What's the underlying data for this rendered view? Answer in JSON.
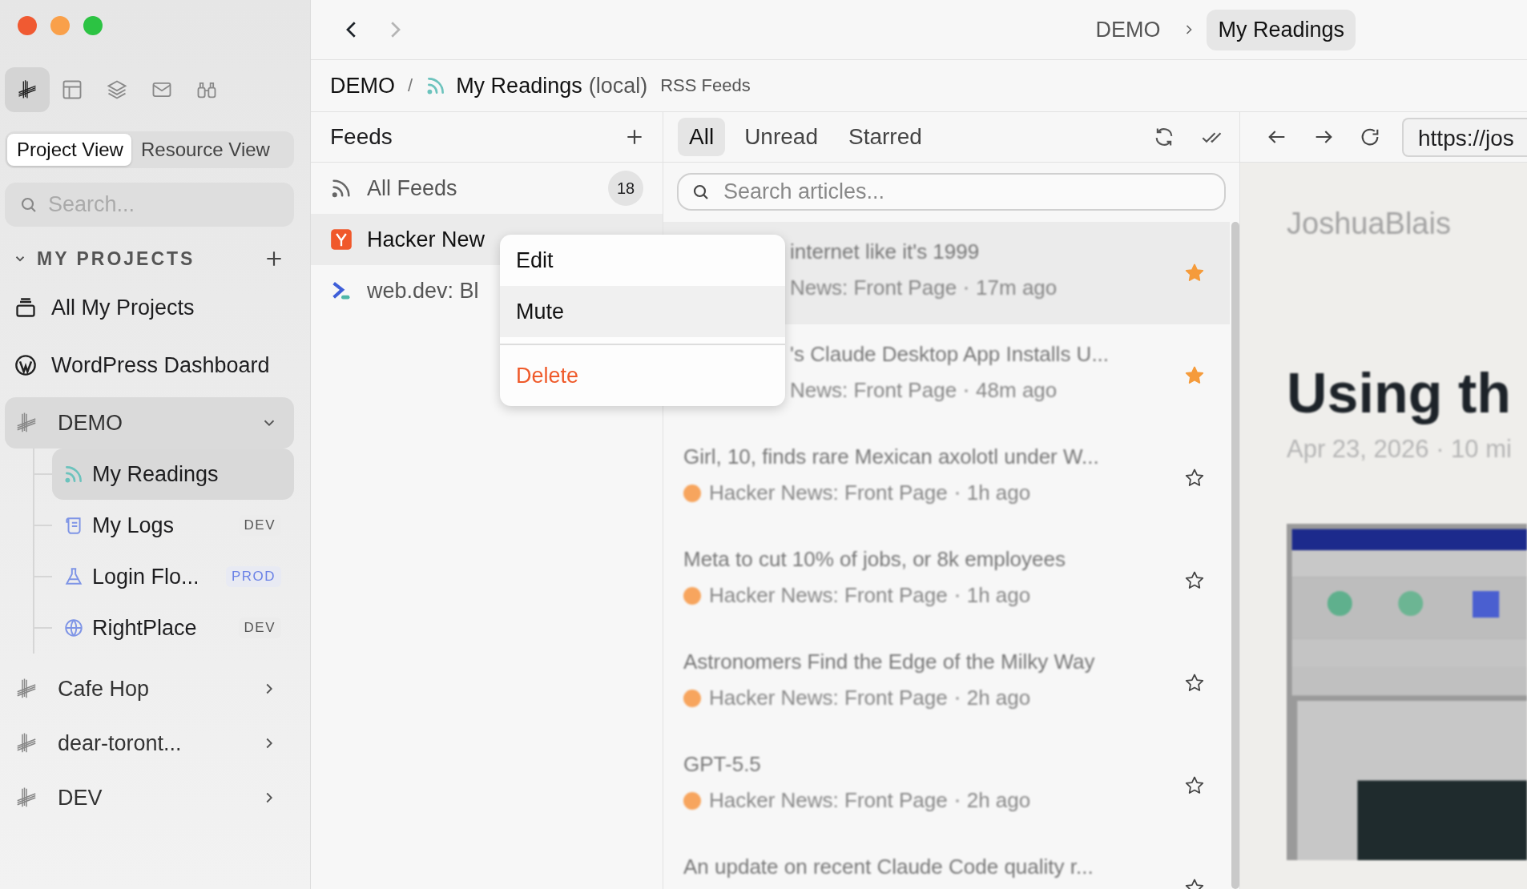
{
  "sidebar": {
    "toolbar": [
      {
        "kind": "hatch",
        "selected": true
      },
      {
        "kind": "layout",
        "selected": false
      },
      {
        "kind": "layers",
        "selected": false
      },
      {
        "kind": "mail",
        "selected": false
      },
      {
        "kind": "binoculars",
        "selected": false
      }
    ],
    "view_tabs": [
      {
        "label": "Project View",
        "selected": true
      },
      {
        "label": "Resource View",
        "selected": false
      }
    ],
    "search": {
      "placeholder": "Search..."
    },
    "section": {
      "title": "MY PROJECTS",
      "expanded": true
    },
    "items": [
      {
        "kind": "stack",
        "label": "All My Projects"
      },
      {
        "kind": "wordpress",
        "label": "WordPress Dashboard"
      }
    ],
    "projects": [
      {
        "label": "DEMO",
        "expanded": true,
        "selected": true,
        "children": [
          {
            "kind": "rss",
            "label": "My Readings",
            "selected": true
          },
          {
            "kind": "logs",
            "label": "My Logs",
            "selected": false,
            "badge": {
              "text": "DEV",
              "kind": "dev"
            }
          },
          {
            "kind": "flask",
            "label": "Login Flo...",
            "selected": false,
            "badge": {
              "text": "PROD",
              "kind": "prod"
            }
          },
          {
            "kind": "globe",
            "label": "RightPlace",
            "selected": false,
            "badge": {
              "text": "DEV",
              "kind": "dev"
            }
          }
        ]
      },
      {
        "label": "Cafe Hop",
        "expanded": false,
        "selected": false
      },
      {
        "label": "dear-toront...",
        "expanded": false,
        "selected": false
      },
      {
        "label": "DEV",
        "expanded": false,
        "selected": false
      }
    ]
  },
  "topbar": {
    "back_disabled": false,
    "forward_disabled": true,
    "crumbs": [
      {
        "label": "DEMO",
        "selected": false
      },
      {
        "label": "My Readings",
        "selected": true
      }
    ]
  },
  "breadcrumb": {
    "project": "DEMO",
    "separator": "/",
    "name": "My Readings",
    "scope": "(local)",
    "type": "RSS Feeds"
  },
  "feeds": {
    "title": "Feeds",
    "items": [
      {
        "kind": "all",
        "label": "All Feeds",
        "count": "18",
        "selected": false
      },
      {
        "kind": "hn",
        "label": "Hacker New",
        "selected": true
      },
      {
        "kind": "webdev",
        "label": "web.dev: Bl",
        "selected": false
      }
    ]
  },
  "context_menu": {
    "items": [
      {
        "label": "Edit",
        "kind": "normal",
        "hovered": false
      },
      {
        "label": "Mute",
        "kind": "normal",
        "hovered": true
      },
      {
        "label": "Delete",
        "kind": "danger",
        "hovered": false
      }
    ]
  },
  "articles": {
    "tabs": [
      {
        "label": "All",
        "selected": true
      },
      {
        "label": "Unread",
        "selected": false
      },
      {
        "label": "Starred",
        "selected": false
      }
    ],
    "search": {
      "placeholder": "Search articles..."
    },
    "items": [
      {
        "kind": "partly_hidden",
        "title": "internet like it's 1999",
        "source": "News: Front Page",
        "time": "17m ago",
        "starred": true,
        "selected": true
      },
      {
        "kind": "partly_hidden",
        "title": "'s Claude Desktop App Installs U...",
        "source": "News: Front Page",
        "time": "48m ago",
        "starred": true,
        "selected": false
      },
      {
        "kind": "full",
        "title": "Girl, 10, finds rare Mexican axolotl under W...",
        "source": "Hacker News: Front Page",
        "time": "1h ago",
        "starred": false,
        "selected": false
      },
      {
        "kind": "full",
        "title": "Meta to cut 10% of jobs, or 8k employees",
        "source": "Hacker News: Front Page",
        "time": "1h ago",
        "starred": false,
        "selected": false
      },
      {
        "kind": "full",
        "title": "Astronomers Find the Edge of the Milky Way",
        "source": "Hacker News: Front Page",
        "time": "2h ago",
        "starred": false,
        "selected": false
      },
      {
        "kind": "full",
        "title": "GPT-5.5",
        "source": "Hacker News: Front Page",
        "time": "2h ago",
        "starred": false,
        "selected": false
      },
      {
        "kind": "title_only",
        "title": "An update on recent Claude Code quality r...",
        "starred": false,
        "selected": false
      }
    ]
  },
  "preview": {
    "url": "https://jos",
    "site": "JoshuaBlais",
    "heading": "Using th",
    "meta": "Apr 23, 2026 · 10 mi"
  }
}
